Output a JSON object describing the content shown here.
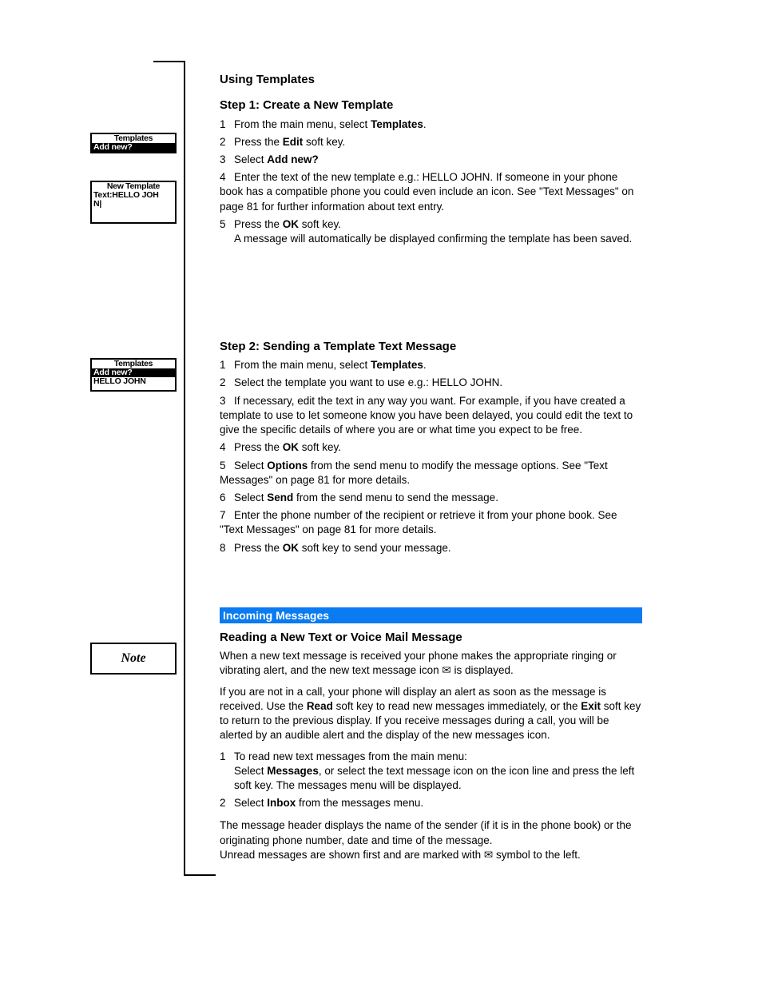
{
  "left": {
    "lcd1": {
      "title": "Templates",
      "row1": "Add new?"
    },
    "lcd2": {
      "title": "New Template",
      "line1": "Text:HELLO JOH",
      "line2": "N|"
    },
    "lcd3": {
      "title": "Templates",
      "row1": "Add new?",
      "row2": "HELLO JOHN"
    },
    "notebox": "Note"
  },
  "intro": {
    "heading": "Using Templates",
    "step1_title": "Step 1: Create a New Template",
    "step1_items": [
      {
        "n": "1",
        "t": "From the main menu, select ",
        "opt": "Templates"
      },
      {
        "n": "2",
        "t": "Press the ",
        "key": "Edit",
        "after": " soft key."
      },
      {
        "n": "3",
        "t": "Select ",
        "opt": "Add new?",
        "after": ""
      },
      {
        "n": "4",
        "t": "Enter the text of the new template e.g.: HELLO JOHN. If someone in your phone book has a compatible phone you could even include an icon. See \"Text Messages\" on page 81 for further information about text entry."
      },
      {
        "n": "5",
        "t": "Press the ",
        "key": "OK",
        "after": " soft key.",
        "extra": "A message will automatically be displayed confirming the template has been saved."
      }
    ],
    "step2_title": "Step 2: Sending a Template Text Message",
    "step2_items": [
      {
        "n": "1",
        "t": "From the main menu, select ",
        "opt": "Templates"
      },
      {
        "n": "2",
        "t": "Select the template you want to use e.g.: HELLO JOHN."
      },
      {
        "n": "3",
        "t": "If necessary, edit the text in any way you want. For example, if you have created a template to use to let someone know you have been delayed, you could edit the text to give the specific details of where you are or what time you expect to be free."
      },
      {
        "n": "4",
        "t": "Press the ",
        "key": "OK",
        "after": " soft key."
      },
      {
        "n": "5",
        "t": "Select ",
        "opt": "Options",
        "after": " from the send menu to modify the message options. See \"Text Messages\" on page 81 for more details."
      },
      {
        "n": "6",
        "t": "Select ",
        "opt": "Send",
        "after": " from the send menu to send the message."
      },
      {
        "n": "7",
        "t": "Enter the phone number of the recipient or retrieve it from your phone book. See \"Text Messages\" on page 81 for more details."
      },
      {
        "n": "8",
        "t": "Press the ",
        "key": "OK",
        "after": " soft key to send your message."
      }
    ]
  },
  "section2": {
    "bluebar": "Incoming Messages",
    "read_title": "Reading a New Text or Voice Mail Message",
    "read_body_1": "When a new text message is received your phone makes the appropriate ringing or vibrating alert, and the new text message icon ",
    "read_icon": "✉",
    "read_body_2": " is displayed.",
    "note_body": "If you are not in a call, your phone will display an alert as soon as the message is received. Use the ",
    "note_key": "Read",
    "note_body_2": " soft key to read new messages immediately, or the ",
    "note_key2": "Exit",
    "note_body_3": " soft key to return to the previous display. If you receive messages during a call, you will be alerted by an audible alert and the display of the new messages icon.",
    "steps": [
      {
        "n": "1",
        "t": "To read new text messages from the main menu:",
        "sub": "Select ",
        "opt": "Messages",
        "tail": ", or select the text message icon on the icon line and press the left soft key. The messages menu will be displayed."
      },
      {
        "n": "2",
        "t": "Select ",
        "opt": "Inbox",
        "tail": " from the messages menu."
      }
    ],
    "foot_1": "The message header displays the name of the sender (if it is in the phone book) or the originating phone number, date and time of the message.",
    "foot_2": "Unread messages are shown first and are marked with ",
    "foot_icon": "✉",
    "foot_3": " symbol to the left."
  }
}
